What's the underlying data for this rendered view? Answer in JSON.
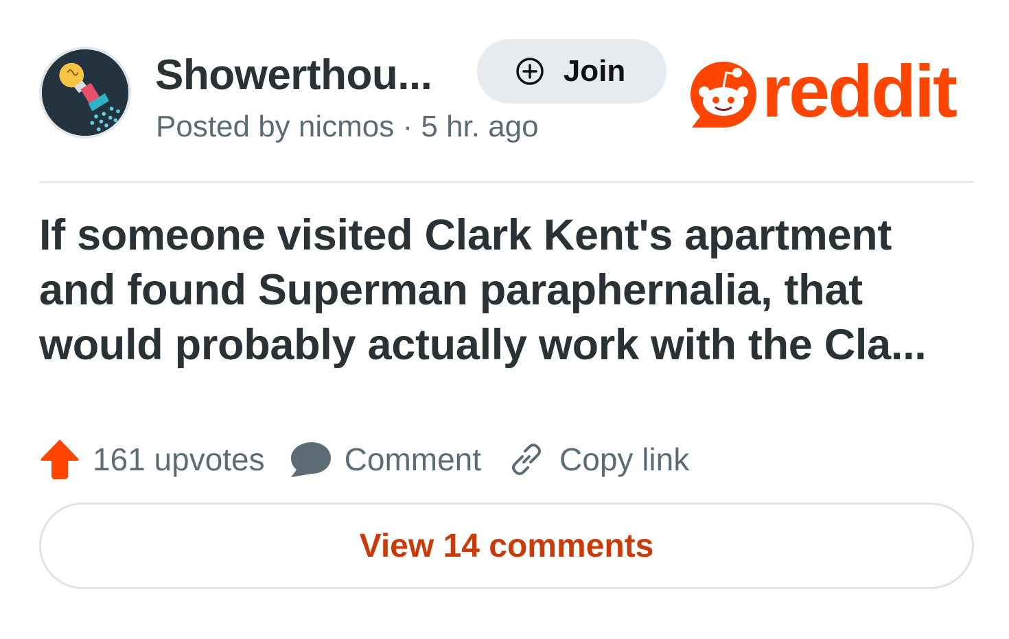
{
  "post_header": {
    "subreddit_name": "Showerthou...",
    "posted_by": "Posted by nicmos · 5 hr. ago",
    "join_label": "Join"
  },
  "brand": {
    "wordmark": "reddit",
    "color": "#ff4500"
  },
  "post": {
    "title": "If someone visited Clark Kent's apartment and found Superman paraphernalia, that would probably actually work with the Cla..."
  },
  "actions": {
    "upvotes": "161 upvotes",
    "comment": "Comment",
    "copy_link": "Copy link"
  },
  "footer": {
    "view_comments": "View 14 comments"
  },
  "icons": {
    "avatar": "lightbulb-shower-icon",
    "join": "plus-circle-icon",
    "upvote": "arrow-up-icon",
    "comment": "chat-bubble-icon",
    "copy_link": "link-icon"
  },
  "colors": {
    "text_primary": "#2a3236",
    "text_secondary": "#5c6c74",
    "upvote": "#ff4500",
    "view_comments": "#c93b0b"
  }
}
